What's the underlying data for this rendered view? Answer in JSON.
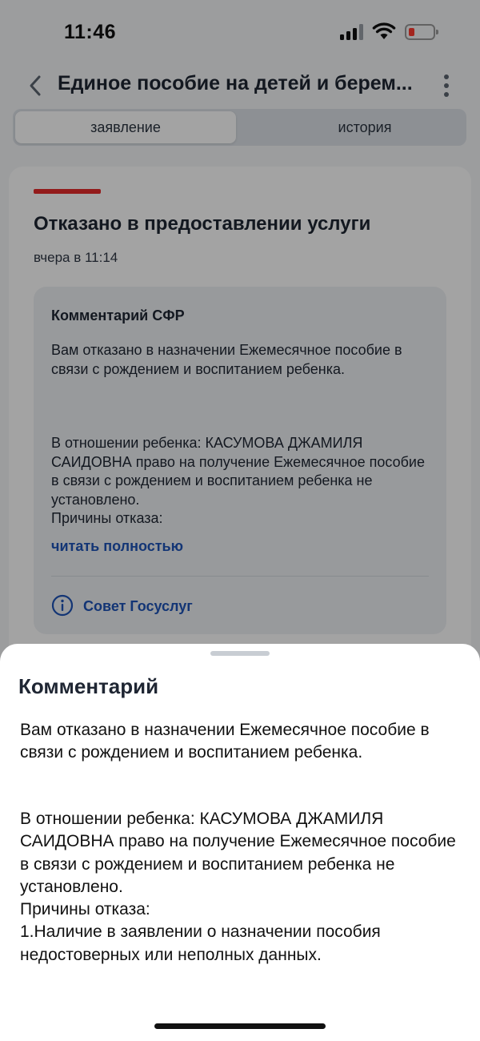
{
  "status_bar": {
    "time": "11:46",
    "battery_color": "#ff3b30",
    "icons": [
      "signal-icon",
      "wifi-icon",
      "battery-icon"
    ]
  },
  "nav": {
    "title": "Единое пособие на детей и берем...",
    "back_icon": "chevron-left-icon",
    "menu_icon": "more-vertical-icon"
  },
  "tabs": [
    {
      "label": "заявление",
      "active": true
    },
    {
      "label": "история",
      "active": false
    }
  ],
  "status_card": {
    "accent_color": "#e62b2b",
    "title": "Отказано в предоставлении услуги",
    "timestamp": "вчера в 11:14",
    "comment": {
      "heading": "Комментарий СФР",
      "text_lines": [
        "Вам отказано в назначении Ежемесячное пособие в связи с рождением и воспитанием ребенка.",
        "В отношении ребенка: КАСУМОВА ДЖАМИЛЯ САИДОВНА право на получение Ежемесячное пособие в связи с рождением и воспитанием ребенка не установлено.",
        "Причины отказа:"
      ],
      "read_more": "читать полностью",
      "tip_label": "Совет Госуслуг",
      "tip_icon": "info-icon",
      "link_color": "#1e54b7"
    }
  },
  "sheet": {
    "title": "Комментарий",
    "paragraph1": "Вам отказано в назначении Ежемесячное пособие в связи с рождением и воспитанием ребенка.",
    "paragraph2": [
      "В отношении ребенка: КАСУМОВА ДЖАМИЛЯ САИДОВНА право на получение Ежемесячное пособие в связи с рождением и воспитанием ребенка не установлено.",
      "Причины отказа:",
      "1.Наличие в заявлении о назначении пособия недостоверных или неполных данных."
    ]
  }
}
